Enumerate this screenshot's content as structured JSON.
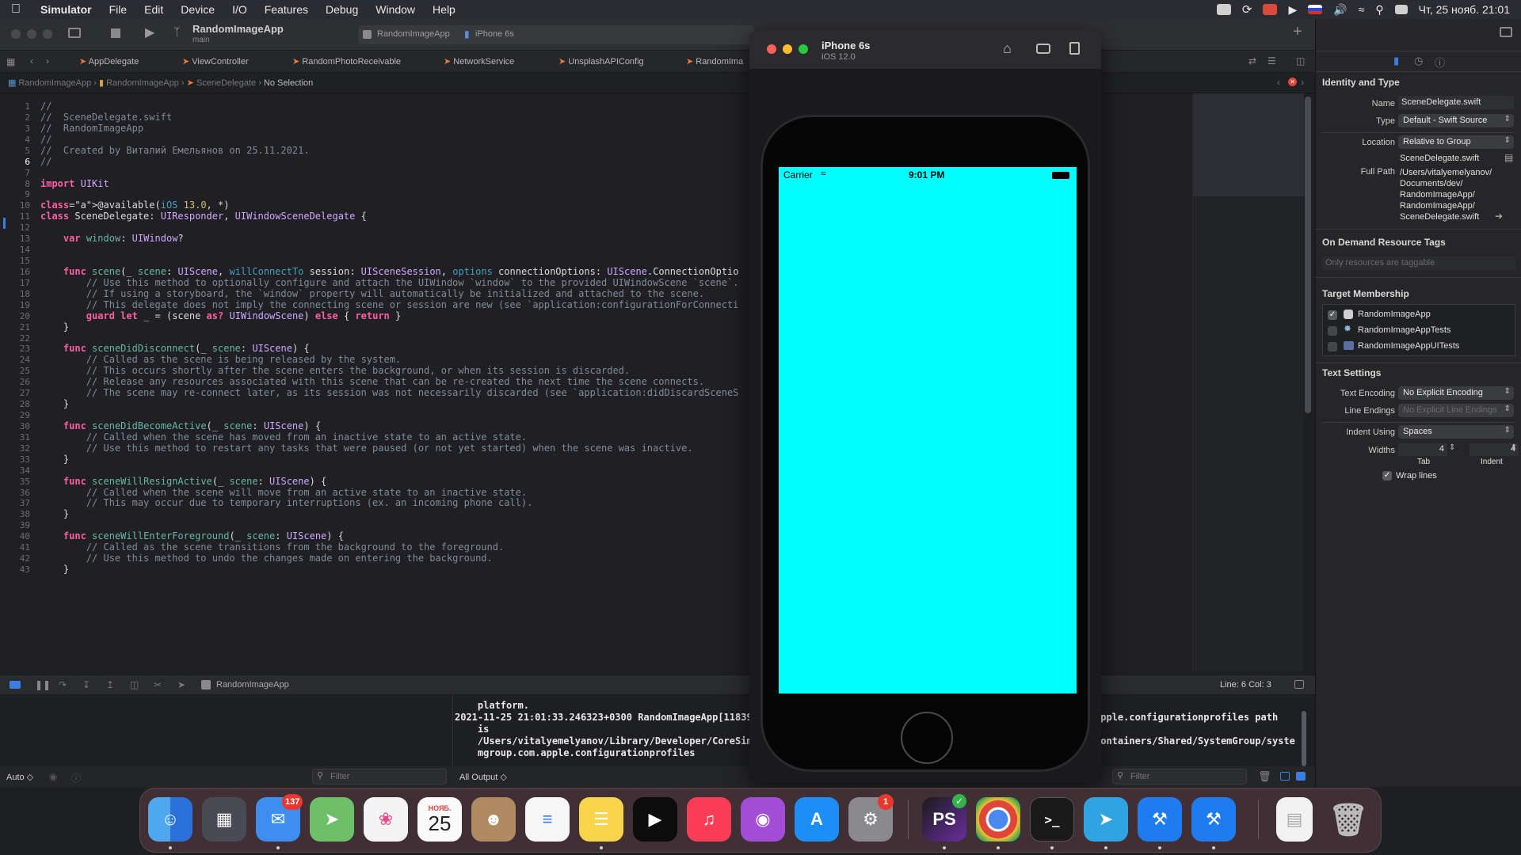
{
  "menubar": {
    "app": "Simulator",
    "items": [
      "File",
      "Edit",
      "Device",
      "I/O",
      "Features",
      "Debug",
      "Window",
      "Help"
    ],
    "datetime": "Чт, 25 нояб.  21:01"
  },
  "toolbar": {
    "project": "RandomImageApp",
    "branch": "main",
    "scheme": "RandomImageApp",
    "device": "iPhone 6s"
  },
  "tabs": [
    "AppDelegate",
    "ViewController",
    "RandomPhotoReceivable",
    "NetworkService",
    "UnsplashAPIConfig",
    "RandomIma"
  ],
  "jumpbar": [
    "RandomImageApp",
    "RandomImageApp",
    "SceneDelegate",
    "No Selection"
  ],
  "editor": {
    "current_line": 6,
    "line_numbers": [
      "1",
      "2",
      "3",
      "4",
      "5",
      "6",
      "7",
      "8",
      "9",
      "10",
      "11",
      "12",
      "13",
      "14",
      "15",
      "16",
      "17",
      "18",
      "19",
      "20",
      "21",
      "22",
      "23",
      "24",
      "25",
      "26",
      "27",
      "28",
      "29",
      "30",
      "31",
      "32",
      "33",
      "34",
      "35",
      "36",
      "37",
      "38",
      "39",
      "40",
      "41",
      "42",
      "43"
    ],
    "lines": [
      "//",
      "//  SceneDelegate.swift",
      "//  RandomImageApp",
      "//",
      "//  Created by Виталий Емельянов on 25.11.2021.",
      "//",
      "",
      "import UIKit",
      "",
      "@available(iOS 13.0, *)",
      "class SceneDelegate: UIResponder, UIWindowSceneDelegate {",
      "",
      "    var window: UIWindow?",
      "",
      "",
      "    func scene(_ scene: UIScene, willConnectTo session: UISceneSession, options connectionOptions: UIScene.ConnectionOptio",
      "        // Use this method to optionally configure and attach the UIWindow `window` to the provided UIWindowScene `scene`.",
      "        // If using a storyboard, the `window` property will automatically be initialized and attached to the scene.",
      "        // This delegate does not imply the connecting scene or session are new (see `application:configurationForConnecti",
      "        guard let _ = (scene as? UIWindowScene) else { return }",
      "    }",
      "",
      "    func sceneDidDisconnect(_ scene: UIScene) {",
      "        // Called as the scene is being released by the system.",
      "        // This occurs shortly after the scene enters the background, or when its session is discarded.",
      "        // Release any resources associated with this scene that can be re-created the next time the scene connects.",
      "        // The scene may re-connect later, as its session was not necessarily discarded (see `application:didDiscardSceneS",
      "    }",
      "",
      "    func sceneDidBecomeActive(_ scene: UIScene) {",
      "        // Called when the scene has moved from an inactive state to an active state.",
      "        // Use this method to restart any tasks that were paused (or not yet started) when the scene was inactive.",
      "    }",
      "",
      "    func sceneWillResignActive(_ scene: UIScene) {",
      "        // Called when the scene will move from an active state to an inactive state.",
      "        // This may occur due to temporary interruptions (ex. an incoming phone call).",
      "    }",
      "",
      "    func sceneWillEnterForeground(_ scene: UIScene) {",
      "        // Called as the scene transitions from the background to the foreground.",
      "        // Use this method to undo the changes made on entering the background.",
      "    }"
    ]
  },
  "statusbar": {
    "scheme": "RandomImageApp",
    "position": "Line: 6  Col: 3"
  },
  "debug": {
    "auto_label": "Auto ◇",
    "filter_placeholder": "Filter",
    "output_label": "All Output ◇",
    "console_lines": [
      "    platform.",
      "2021-11-25 21:01:33.246323+0300 RandomImageApp[11839",
      "    is",
      "    /Users/vitalyemelyanov/Library/Developer/CoreSim",
      "    mgroup.com.apple.configurationprofiles"
    ],
    "console_right_lines": [
      "apple.configurationprofiles path",
      "",
      "Containers/Shared/SystemGroup/syste"
    ]
  },
  "inspector": {
    "identity_title": "Identity and Type",
    "name_label": "Name",
    "name_value": "SceneDelegate.swift",
    "type_label": "Type",
    "type_value": "Default - Swift Source",
    "location_label": "Location",
    "location_value": "Relative to Group",
    "location_file": "SceneDelegate.swift",
    "fullpath_label": "Full Path",
    "fullpath_lines": [
      "/Users/vitalyemelyanov/",
      "Documents/dev/",
      "RandomImageApp/",
      "RandomImageApp/",
      "SceneDelegate.swift"
    ],
    "ondemand_title": "On Demand Resource Tags",
    "ondemand_placeholder": "Only resources are taggable",
    "target_title": "Target Membership",
    "targets": [
      {
        "name": "RandomImageApp",
        "checked": true
      },
      {
        "name": "RandomImageAppTests",
        "checked": false
      },
      {
        "name": "RandomImageAppUITests",
        "checked": false
      }
    ],
    "text_title": "Text Settings",
    "encoding_label": "Text Encoding",
    "encoding_value": "No Explicit Encoding",
    "endings_label": "Line Endings",
    "endings_value": "No Explicit Line Endings",
    "indent_label": "Indent Using",
    "indent_value": "Spaces",
    "widths_label": "Widths",
    "tab_value": "4",
    "indent_value_num": "4",
    "tab_label": "Tab",
    "indent_label2": "Indent",
    "wrap_label": "Wrap lines"
  },
  "simulator": {
    "title": "iPhone 6s",
    "subtitle": "iOS 12.0",
    "carrier": "Carrier",
    "time": "9:01 PM",
    "screen_color": "#00ffff"
  },
  "dock": {
    "mail_badge": "137",
    "calendar_month": "НОЯБ.",
    "calendar_day": "25",
    "settings_badge": "1",
    "ps_label": "PS",
    "terminal_label": ">_"
  }
}
